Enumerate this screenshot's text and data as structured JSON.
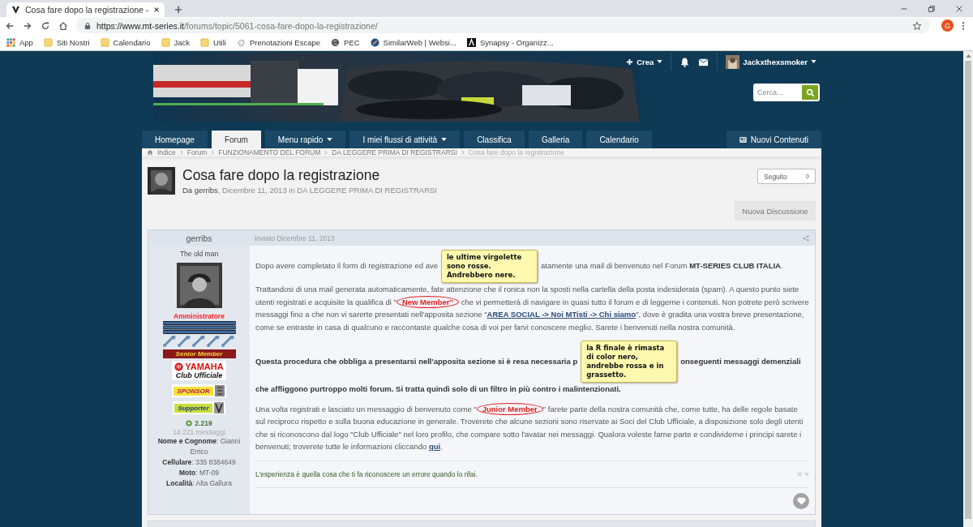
{
  "browser": {
    "tab_title": "Cosa fare dopo la registrazione -",
    "url_host": "https://www.mt-series.it",
    "url_path": "/forums/topic/5061-cosa-fare-dopo-la-registrazione/",
    "profile": "G",
    "bookmarks": [
      {
        "label": "App",
        "kind": "apps"
      },
      {
        "label": "Siti Nostri",
        "kind": "folder"
      },
      {
        "label": "Calendario",
        "kind": "folder"
      },
      {
        "label": "Jack",
        "kind": "folder"
      },
      {
        "label": "Utili",
        "kind": "folder"
      },
      {
        "label": "Prenotazioni Escape",
        "kind": "page"
      },
      {
        "label": "PEC",
        "kind": "globe"
      },
      {
        "label": "SimilarWeb | Websi...",
        "kind": "similar"
      },
      {
        "label": "Synapsy - Organizz...",
        "kind": "synapsy"
      }
    ]
  },
  "header": {
    "create": "Crea",
    "username": "Jackxthexsmoker",
    "search": {
      "placeholder": "Cerca..."
    }
  },
  "nav": {
    "tabs": [
      {
        "label": "Homepage",
        "selected": false,
        "dropdown": false
      },
      {
        "label": "Forum",
        "selected": true,
        "dropdown": false
      },
      {
        "label": "Menu rapido",
        "selected": false,
        "dropdown": true
      },
      {
        "label": "I miei flussi di attività",
        "selected": false,
        "dropdown": true
      },
      {
        "label": "Classifica",
        "selected": false,
        "dropdown": false
      },
      {
        "label": "Galleria",
        "selected": false,
        "dropdown": false
      },
      {
        "label": "Calendario",
        "selected": false,
        "dropdown": false
      }
    ],
    "new_content": "Nuovi Contenuti"
  },
  "breadcrumb": {
    "items": [
      "Indice",
      "Forum",
      "FUNZIONAMENTO DEL FORUM",
      "DA LEGGERE PRIMA DI REGISTRARSI"
    ],
    "current": "Cosa fare dopo la registrazione"
  },
  "topic": {
    "title": "Cosa fare dopo la registrazione",
    "author_prefix": "Da",
    "author": "gerribs",
    "date": ", Dicembre 11, 2013 in",
    "forum": "DA LEGGERE PRIMA DI REGISTRARSI",
    "follow": "Seguito",
    "follow_count": "0",
    "new_button": "Nuova Discussione"
  },
  "post": {
    "author": "gerribs",
    "user_title": "The old man",
    "group": "Amministratore",
    "badges": [
      {
        "kind": "senior",
        "text": "Senior Member"
      },
      {
        "kind": "yamaha",
        "text": "YAMAHA",
        "sub": "Club Ufficiale"
      },
      {
        "kind": "sponsor",
        "text": "SPONSOR"
      },
      {
        "kind": "supporter",
        "text": "Supporter"
      }
    ],
    "reputation": "2.219",
    "posts": "14.221 messaggi",
    "fields": [
      "**Nome e Cognome**: Gianni Errico",
      "**Cellulare**: 335 8384649",
      "**Moto**: MT-09",
      "**Località**: Alta Gallura"
    ],
    "date": "Inviato Dicembre 11, 2013",
    "paragraphs": [
      {
        "bold": false,
        "runs": [
          {
            "kind": "text",
            "text": "Dopo avere completato il form di registrazione ed ave"
          },
          {
            "kind": "note",
            "text": "le ultime virgolette sono rosse. Andrebbero nere."
          },
          {
            "kind": "text",
            "text": "atamente una mail di benvenuto nel Forum **MT-SERIES CLUB ITALIA**. Trattandosi di una mail generata automaticamente, fate attenzione che il"
          },
          {
            "kind": "text",
            "text": " ronica non la sposti nella cartella della posta indesiderata (spam). A questo punto siete utenti registrati e acquisite la qualifica di \""
          },
          {
            "kind": "member",
            "text": "New Member\""
          },
          {
            "kind": "text",
            "text": " che vi permetterà di navigare in quasi tutto il forum e di leggerne i contenuti. Non potrete però scrivere messaggi fino a che non vi sarerte presentati nell'apposita sezione \""
          },
          {
            "kind": "link",
            "text": "AREA SOCIAL -> Noi MTisti -> Chi siamo"
          },
          {
            "kind": "text",
            "text": "\", dove è gradita una vostra breve presentazione, come se entraste in casa di qualcuno e raccontaste qualche cosa di voi per farvi conoscere meglio. Sarete i benvenuti nella nostra comunità."
          }
        ]
      },
      {
        "bold": true,
        "runs": [
          {
            "kind": "text",
            "text": "Questa procedura che obbliga a presentarsi nell'apposita sezione si è resa necessaria p"
          },
          {
            "kind": "note",
            "text": "la R finale è rimasta di color nero, andrebbe rossa e in grassetto."
          },
          {
            "kind": "text",
            "text": "onseguenti messaggi demenziali che affliggono purtroppo molti forum. Si tratta quindi solo di un filtro in più contro i malintenzionati."
          }
        ]
      },
      {
        "bold": false,
        "runs": [
          {
            "kind": "text",
            "text": "Una volta registrati e lasciato un messaggio di benvenuto come \""
          },
          {
            "kind": "member",
            "text": "Junior Member"
          },
          {
            "kind": "text",
            "text": "\" farete parte della nostra comunità che, come tutte, ha delle regole basate sul reciproco rispetto e sulla buona educazione in generale. Troverete che alcune sezioni sono riservate ai Soci del Club Ufficiale, a disposizione solo degli utenti che si riconoscono dal logo \"Club Ufficiale\" nel loro profilo, che compare sotto l'avatar nei messaggi. Qualora voleste farne parte e condividerne i principi sarete i benvenuti; troverete tutte le informazioni cliccando "
          },
          {
            "kind": "link",
            "text": "qui"
          },
          {
            "kind": "text",
            "text": "."
          }
        ]
      }
    ],
    "signature": "L'esperienza è quella cosa che ti fa riconoscere un errore quando lo rifai.",
    "liked": false
  }
}
